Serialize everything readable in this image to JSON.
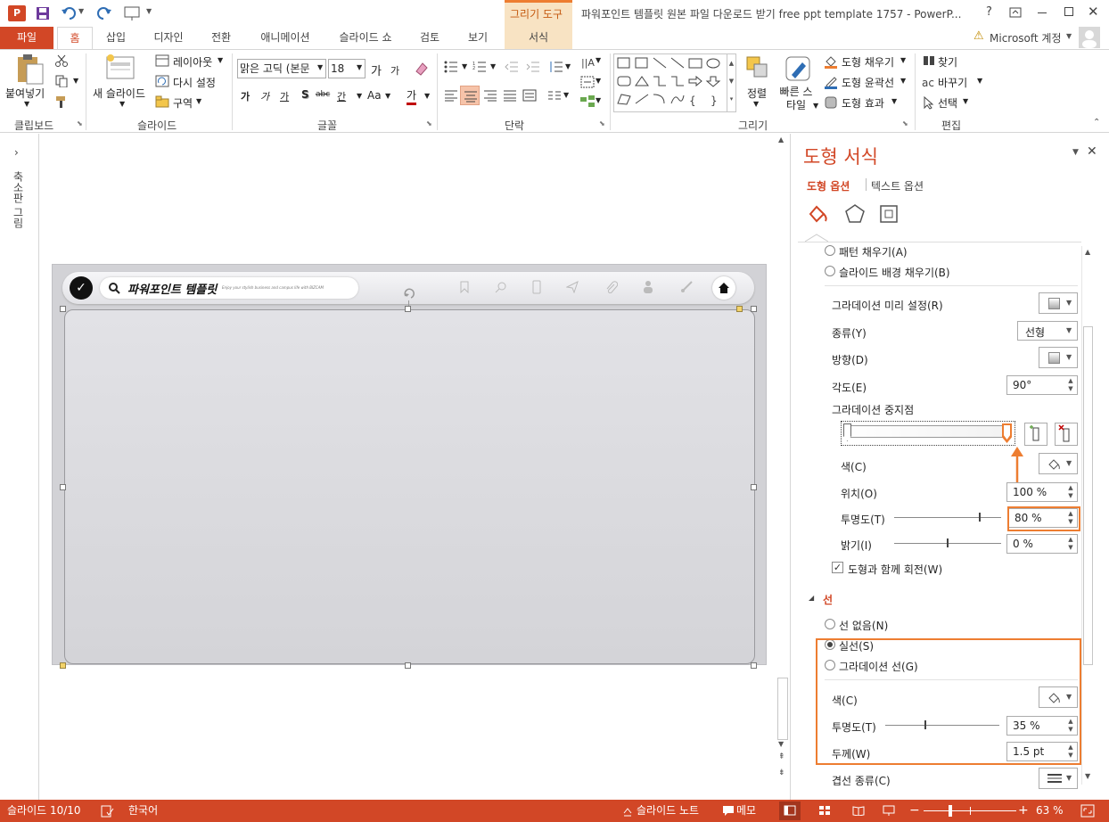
{
  "window": {
    "title": "파워포인트 템플릿 원본 파일 다운로드 받기 free ppt template 1757 - PowerP...",
    "context_tab_group": "그리기 도구",
    "help": "?",
    "account": "Microsoft 계정"
  },
  "tabs": [
    "파일",
    "홈",
    "삽입",
    "디자인",
    "전환",
    "애니메이션",
    "슬라이드 쇼",
    "검토",
    "보기",
    "서식"
  ],
  "ribbon": {
    "clipboard": {
      "label": "클립보드",
      "paste": "붙여넣기"
    },
    "slides": {
      "label": "슬라이드",
      "new_slide": "새 슬라이드",
      "layout": "레이아웃",
      "reset": "다시 설정",
      "section": "구역"
    },
    "font": {
      "label": "글꼴",
      "font_name": "맑은 고딕 (본문",
      "font_size": "18",
      "grow": "가",
      "shrink": "가",
      "bold": "가",
      "italic": "가",
      "underline": "가",
      "shadow": "S",
      "strike": "abc",
      "spacing": "간",
      "case": "Aa",
      "color": "가"
    },
    "paragraph": {
      "label": "단락"
    },
    "drawing": {
      "label": "그리기",
      "arrange": "정렬",
      "quick_styles": "빠른 스타일",
      "shape_fill": "도형 채우기",
      "shape_outline": "도형 윤곽선",
      "shape_effects": "도형 효과"
    },
    "editing": {
      "label": "편집",
      "find": "찾기",
      "replace": "바꾸기",
      "select": "선택"
    }
  },
  "thumbnail_strip": {
    "label": "축소판 그림"
  },
  "slide": {
    "brand": "파워포인트 템플릿",
    "tagline": "Enjoy your stylish business and campus life with BIZCAM"
  },
  "pane": {
    "title": "도형 서식",
    "tab_shape": "도형 옵션",
    "tab_text": "텍스트 옵션",
    "fill": {
      "pattern_fill": "패턴 채우기(A)",
      "slide_bg_fill": "슬라이드 배경 채우기(B)",
      "preset": "그라데이션 미리 설정(R)",
      "type_label": "종류(Y)",
      "type_value": "선형",
      "direction": "방향(D)",
      "angle_label": "각도(E)",
      "angle_value": "90°",
      "stops": "그라데이션 중지점",
      "color": "색(C)",
      "position_label": "위치(O)",
      "position_value": "100 %",
      "transparency_label": "투명도(T)",
      "transparency_value": "80 %",
      "transparency_level": 80,
      "brightness_label": "밝기(I)",
      "brightness_value": "0 %",
      "brightness_level": 0,
      "rotate_with_shape": "도형과 함께 회전(W)"
    },
    "line": {
      "section": "선",
      "no_line": "선 없음(N)",
      "solid": "실선(S)",
      "gradient_line": "그라데이션 선(G)",
      "color": "색(C)",
      "transparency_label": "투명도(T)",
      "transparency_value": "35 %",
      "transparency_level": 35,
      "width_label": "두께(W)",
      "width_value": "1.5 pt",
      "compound_type": "겹선 종류(C)"
    }
  },
  "status": {
    "slide": "슬라이드 10/10",
    "language": "한국어",
    "notes": "슬라이드 노트",
    "comments": "메모",
    "zoom": "63 %"
  },
  "colors": {
    "accent": "#d24726",
    "highlight": "#ed7d31",
    "context_tab": "#f8e3c3"
  }
}
